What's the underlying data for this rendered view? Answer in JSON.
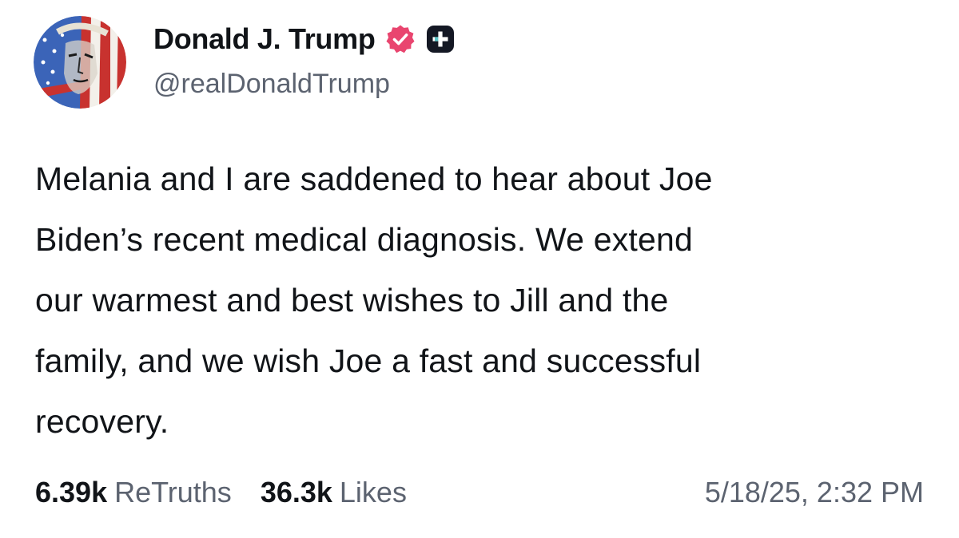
{
  "author": {
    "display_name": "Donald J. Trump",
    "handle": "@realDonaldTrump",
    "verified_icon": "verified-badge-icon",
    "verified_color": "#e9456f",
    "plus_icon": "plus-badge-icon",
    "plus_color": "#141824"
  },
  "post": {
    "text": "Melania and I are saddened to hear about Joe\nBiden’s recent medical diagnosis. We extend\nour warmest and best wishes to Jill and the\nfamily, and we wish Joe a fast and successful\nrecovery."
  },
  "stats": {
    "retruths_count": "6.39k",
    "retruths_label": "ReTruths",
    "likes_count": "36.3k",
    "likes_label": "Likes"
  },
  "timestamp": "5/18/25, 2:32 PM"
}
